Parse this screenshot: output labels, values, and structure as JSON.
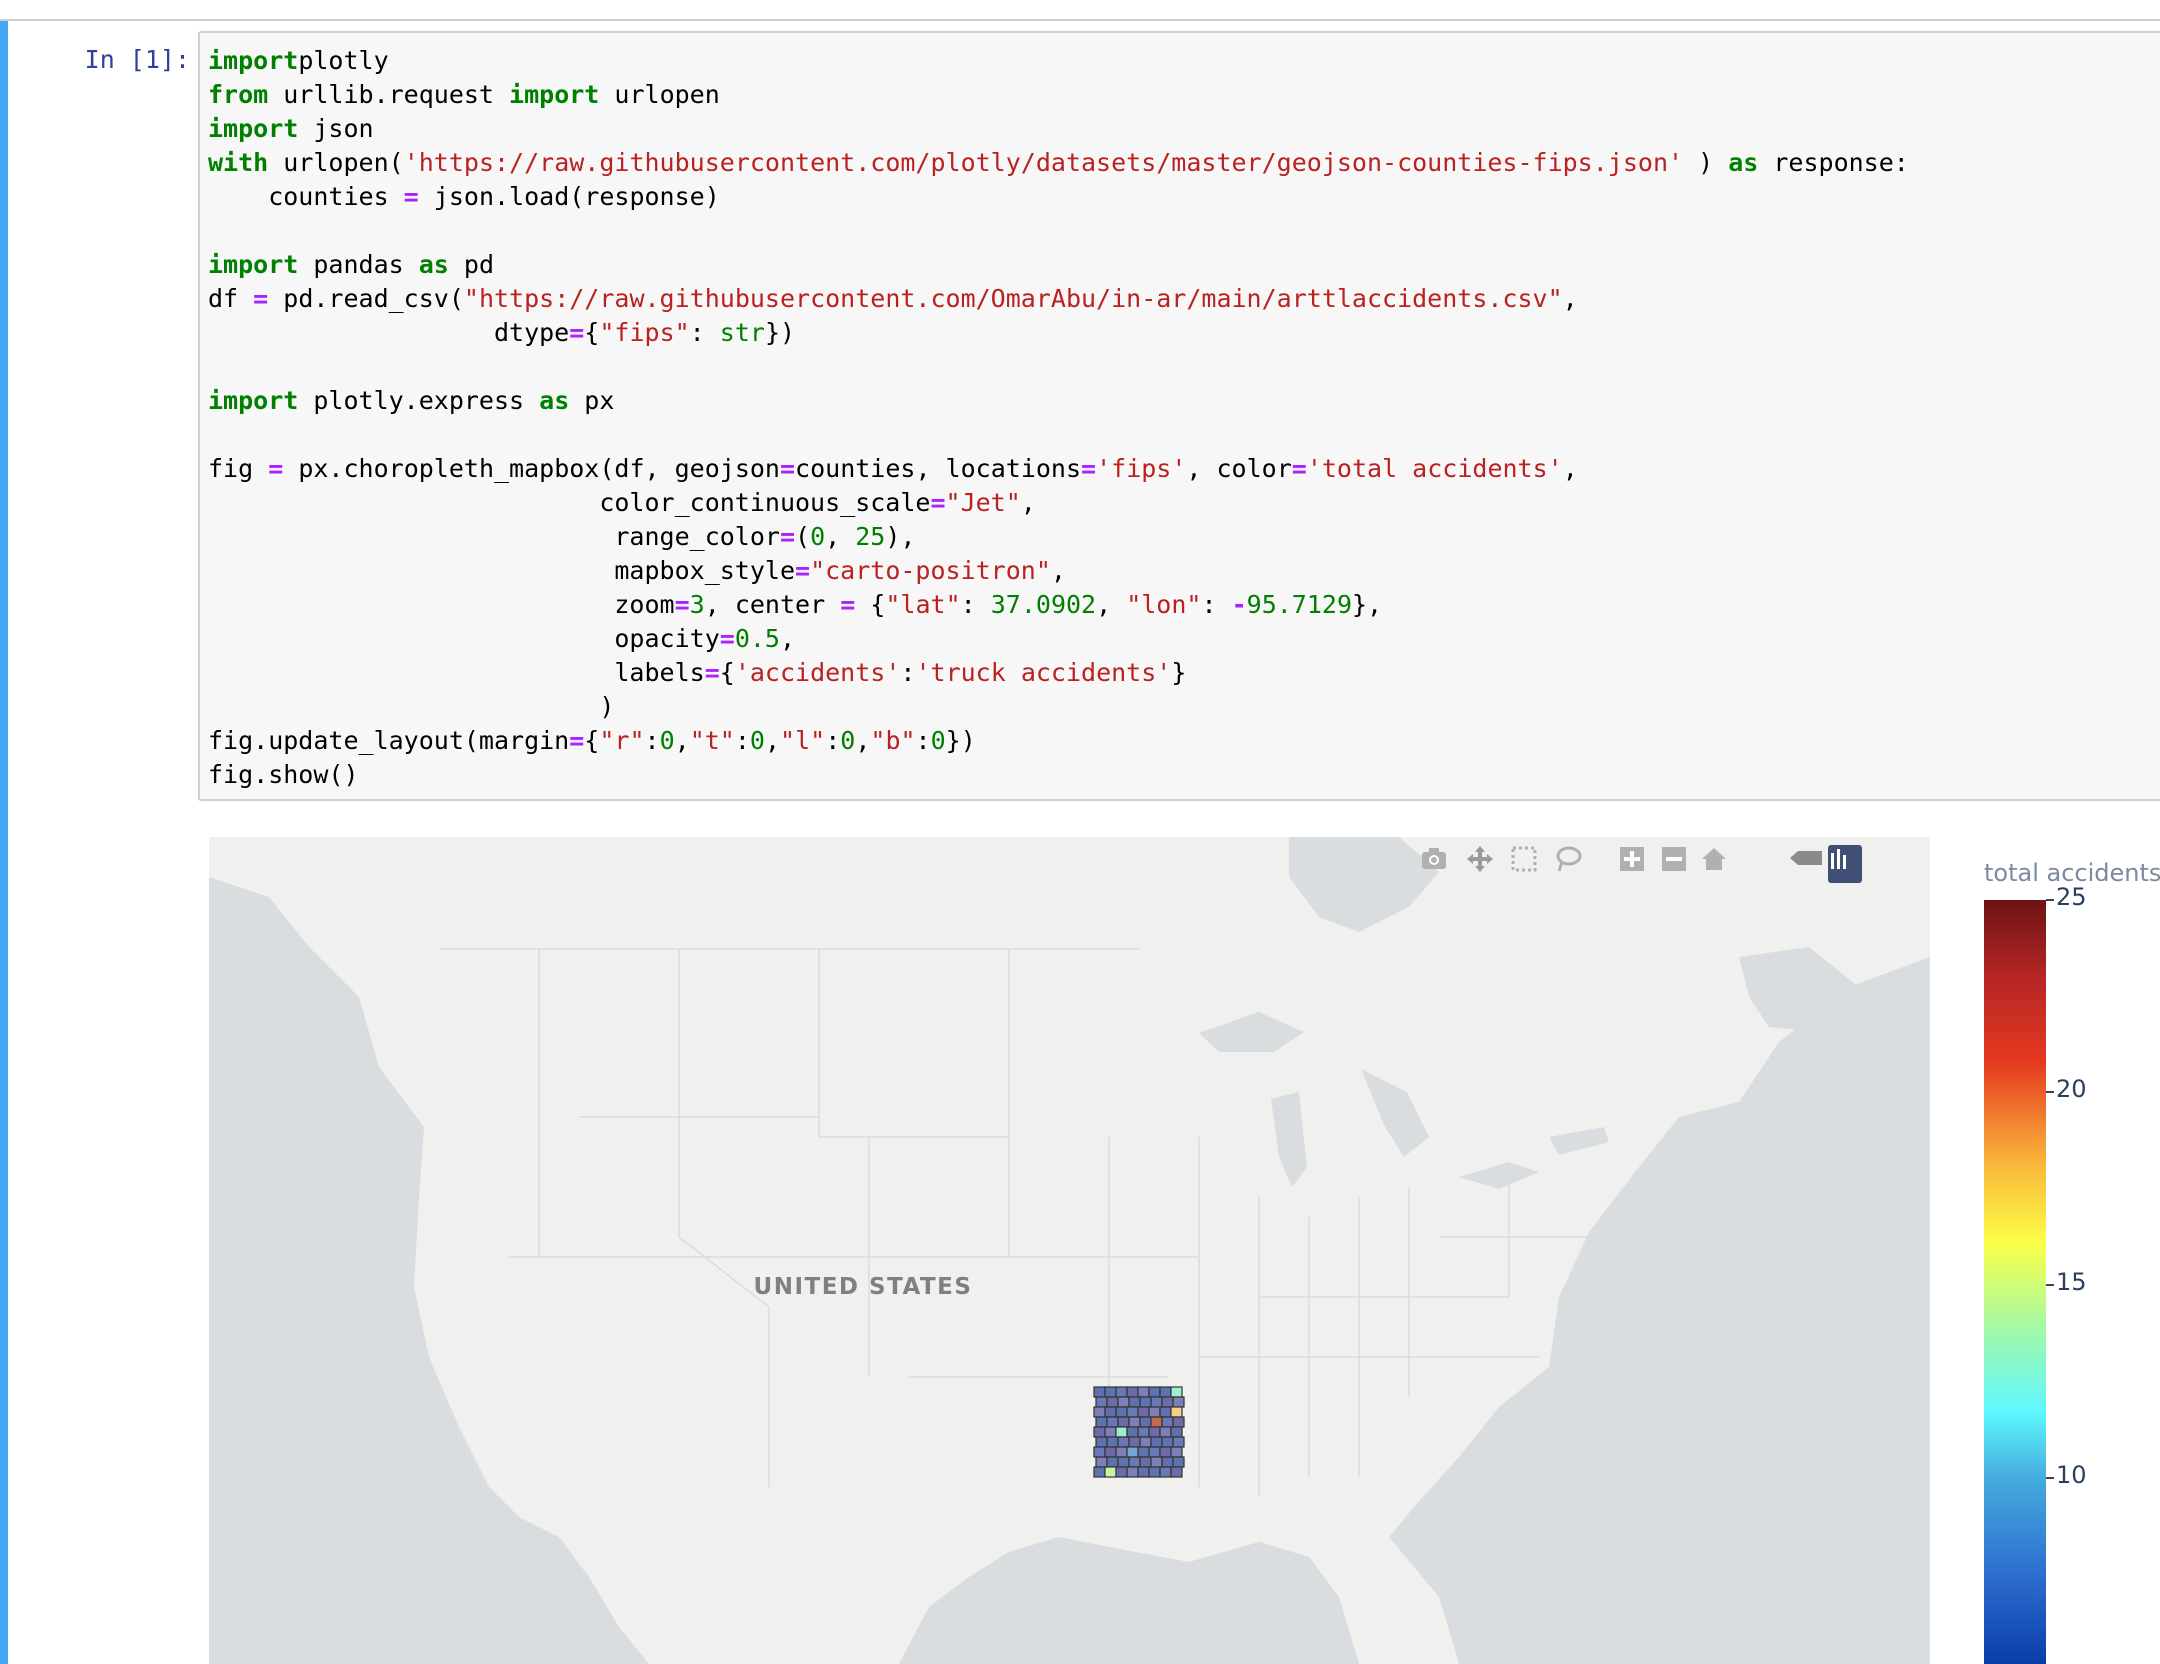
{
  "cell": {
    "prompt": "In [1]:",
    "lines": [
      [
        [
          "kw",
          "import"
        ],
        [
          "",
          "plotly"
        ]
      ],
      [
        [
          "kw",
          "from"
        ],
        [
          "",
          " urllib.request "
        ],
        [
          "kw",
          "import"
        ],
        [
          "",
          " urlopen"
        ]
      ],
      [
        [
          "kw",
          "import"
        ],
        [
          "",
          " json"
        ]
      ],
      [
        [
          "kw",
          "with"
        ],
        [
          "",
          " urlopen("
        ],
        [
          "st",
          "'https://raw.githubusercontent.com/plotly/datasets/master/geojson-counties-fips.json'"
        ],
        [
          "",
          " ) "
        ],
        [
          "kw",
          "as"
        ],
        [
          "",
          " response:"
        ]
      ],
      [
        [
          "",
          "    counties "
        ],
        [
          "op",
          "="
        ],
        [
          "",
          " json.load(response)"
        ]
      ],
      [
        [
          "",
          ""
        ]
      ],
      [
        [
          "kw",
          "import"
        ],
        [
          "",
          " pandas "
        ],
        [
          "kw",
          "as"
        ],
        [
          "",
          " pd"
        ]
      ],
      [
        [
          "",
          "df "
        ],
        [
          "op",
          "="
        ],
        [
          "",
          " pd.read_csv("
        ],
        [
          "st",
          "\"https://raw.githubusercontent.com/OmarAbu/in-ar/main/arttlaccidents.csv\""
        ],
        [
          "",
          ","
        ]
      ],
      [
        [
          "",
          "                   dtype"
        ],
        [
          "op",
          "="
        ],
        [
          "",
          "{"
        ],
        [
          "st",
          "\"fips\""
        ],
        [
          "",
          ": "
        ],
        [
          "bi",
          "str"
        ],
        [
          "",
          "})"
        ]
      ],
      [
        [
          "",
          ""
        ]
      ],
      [
        [
          "kw",
          "import"
        ],
        [
          "",
          " plotly.express "
        ],
        [
          "kw",
          "as"
        ],
        [
          "",
          " px"
        ]
      ],
      [
        [
          "",
          ""
        ]
      ],
      [
        [
          "",
          "fig "
        ],
        [
          "op",
          "="
        ],
        [
          "",
          " px.choropleth_mapbox(df, geojson"
        ],
        [
          "op",
          "="
        ],
        [
          "",
          "counties, locations"
        ],
        [
          "op",
          "="
        ],
        [
          "st",
          "'fips'"
        ],
        [
          "",
          ", color"
        ],
        [
          "op",
          "="
        ],
        [
          "st",
          "'total accidents'"
        ],
        [
          "",
          ","
        ]
      ],
      [
        [
          "",
          "                          color_continuous_scale"
        ],
        [
          "op",
          "="
        ],
        [
          "st",
          "\"Jet\""
        ],
        [
          "",
          ","
        ]
      ],
      [
        [
          "",
          "                           range_color"
        ],
        [
          "op",
          "="
        ],
        [
          "",
          "("
        ],
        [
          "nm",
          "0"
        ],
        [
          "",
          ", "
        ],
        [
          "nm",
          "25"
        ],
        [
          "",
          "),"
        ]
      ],
      [
        [
          "",
          "                           mapbox_style"
        ],
        [
          "op",
          "="
        ],
        [
          "st",
          "\"carto-positron\""
        ],
        [
          "",
          ","
        ]
      ],
      [
        [
          "",
          "                           zoom"
        ],
        [
          "op",
          "="
        ],
        [
          "nm",
          "3"
        ],
        [
          "",
          ", center "
        ],
        [
          "op",
          "="
        ],
        [
          "",
          " {"
        ],
        [
          "st",
          "\"lat\""
        ],
        [
          "",
          ": "
        ],
        [
          "nm",
          "37.0902"
        ],
        [
          "",
          ", "
        ],
        [
          "st",
          "\"lon\""
        ],
        [
          "",
          ": "
        ],
        [
          "op",
          "-"
        ],
        [
          "nm",
          "95.7129"
        ],
        [
          "",
          "},"
        ]
      ],
      [
        [
          "",
          "                           opacity"
        ],
        [
          "op",
          "="
        ],
        [
          "nm",
          "0.5"
        ],
        [
          "",
          ","
        ]
      ],
      [
        [
          "",
          "                           labels"
        ],
        [
          "op",
          "="
        ],
        [
          "",
          "{"
        ],
        [
          "st",
          "'accidents'"
        ],
        [
          "",
          ":"
        ],
        [
          "st",
          "'truck accidents'"
        ],
        [
          "",
          "}"
        ]
      ],
      [
        [
          "",
          "                          )"
        ]
      ],
      [
        [
          "",
          "fig.update_layout(margin"
        ],
        [
          "op",
          "="
        ],
        [
          "",
          "{"
        ],
        [
          "st",
          "\"r\""
        ],
        [
          "",
          ":"
        ],
        [
          "nm",
          "0"
        ],
        [
          "",
          ","
        ],
        [
          "st",
          "\"t\""
        ],
        [
          "",
          ":"
        ],
        [
          "nm",
          "0"
        ],
        [
          "",
          ","
        ],
        [
          "st",
          "\"l\""
        ],
        [
          "",
          ":"
        ],
        [
          "nm",
          "0"
        ],
        [
          "",
          ","
        ],
        [
          "st",
          "\"b\""
        ],
        [
          "",
          ":"
        ],
        [
          "nm",
          "0"
        ],
        [
          "",
          "})"
        ]
      ],
      [
        [
          "",
          "fig.show()"
        ]
      ]
    ]
  },
  "map": {
    "country_label": "UNITED STATES",
    "colors": {
      "land": "#f0f0ee",
      "water": "#d9dcdf",
      "border": "#d8d8d8"
    },
    "county_colors": [
      "#5f6fb0",
      "#6a78b5",
      "#7d7fb8",
      "#5c74ad",
      "#6d6aa8",
      "#74a8d6",
      "#9bf0cf",
      "#c6f4a7",
      "#f3d08a",
      "#c26b4d"
    ]
  },
  "modebar": {
    "icons": [
      "camera-icon",
      "pan-icon",
      "box-select-icon",
      "lasso-icon",
      "zoom-in-icon",
      "zoom-out-icon",
      "reset-view-icon",
      "hover-icon",
      "plotly-logo-icon"
    ]
  },
  "colorbar": {
    "title": "total accidents",
    "range": [
      5,
      25
    ],
    "ticks": [
      "25",
      "20",
      "15",
      "10"
    ]
  }
}
